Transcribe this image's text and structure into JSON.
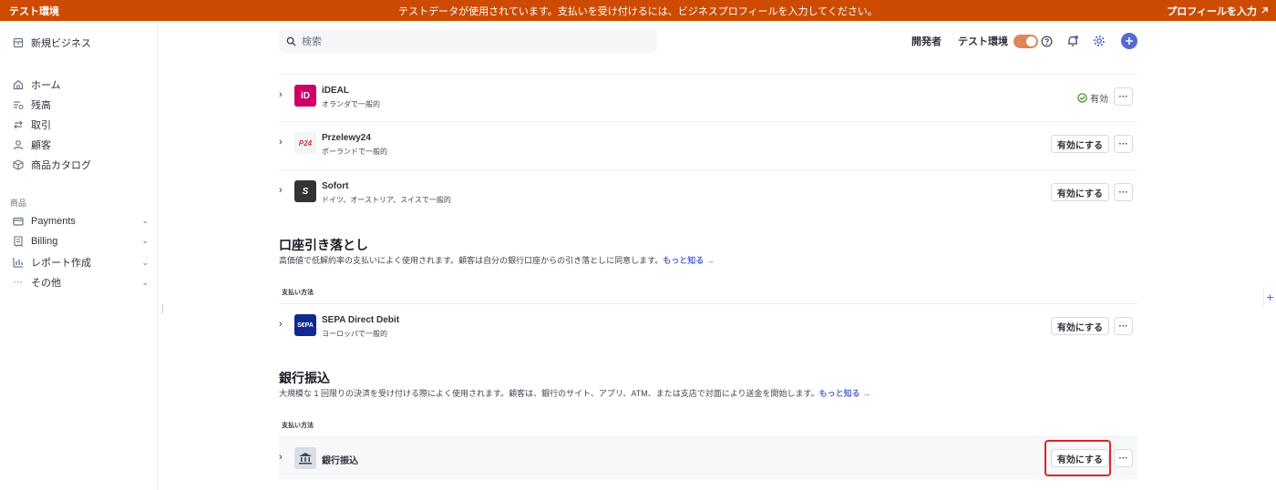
{
  "banner": {
    "env_label": "テスト環境",
    "message": "テストデータが使用されています。支払いを受け付けるには、ビジネスプロフィールを入力してください。",
    "action_label": "プロフィールを入力"
  },
  "sidebar": {
    "business_name": "新規ビジネス",
    "nav": [
      {
        "label": "ホーム"
      },
      {
        "label": "残高"
      },
      {
        "label": "取引"
      },
      {
        "label": "顧客"
      },
      {
        "label": "商品カタログ"
      }
    ],
    "section_label": "商品",
    "products": [
      {
        "label": "Payments"
      },
      {
        "label": "Billing"
      },
      {
        "label": "レポート作成"
      },
      {
        "label": "その他"
      }
    ]
  },
  "search": {
    "placeholder": "検索"
  },
  "header": {
    "developer_label": "開発者",
    "test_mode_label": "テスト環境"
  },
  "methods": [
    {
      "name": "iDEAL",
      "description": "オランダで一般的",
      "status": "有効"
    },
    {
      "name": "Przelewy24",
      "description": "ポーランドで一般的",
      "action": "有効にする"
    },
    {
      "name": "Sofort",
      "description": "ドイツ、オーストリア、スイスで一般的",
      "action": "有効にする"
    }
  ],
  "debit_section": {
    "title": "口座引き落とし",
    "description": "高価値で低解約率の支払いによく使用されます。顧客は自分の銀行口座からの引き落としに同意します。",
    "link": "もっと知る →",
    "sub_header": "支払い方法",
    "methods": [
      {
        "name": "SEPA Direct Debit",
        "description": "ヨーロッパで一般的",
        "action": "有効にする",
        "logo_text": "S€PA"
      }
    ]
  },
  "bank_section": {
    "title": "銀行振込",
    "description": "大規模な 1 回限りの決済を受け付ける際によく使用されます。顧客は、銀行のサイト、アプリ、ATM、または支店で対面により送金を開始します。",
    "link": "もっと知る →",
    "sub_header": "支払い方法",
    "methods": [
      {
        "name": "銀行振込",
        "action": "有効にする"
      }
    ]
  },
  "more_label": "···",
  "colors": {
    "banner": "#cc4b00",
    "accent": "#5469d4",
    "highlight": "#e02424"
  }
}
